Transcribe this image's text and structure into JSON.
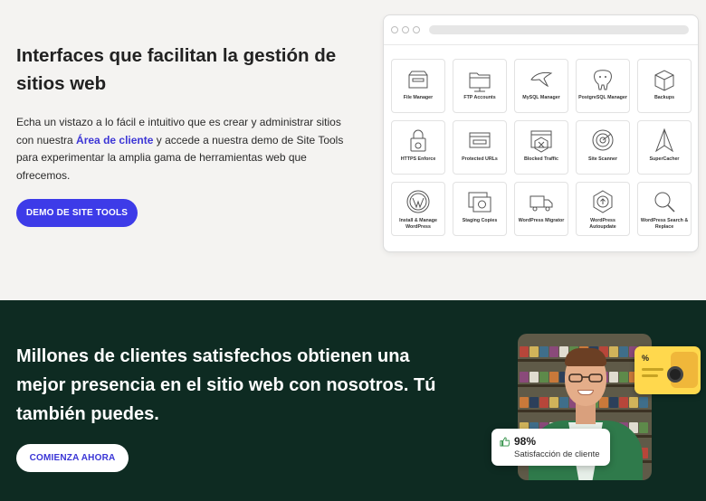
{
  "top": {
    "title": "Interfaces que facilitan la gestión de sitios web",
    "desc_before": "Echa un vistazo a lo fácil e intuitivo que es crear y administrar sitios con nuestra ",
    "desc_link": "Área de cliente",
    "desc_after": " y accede a nuestra demo de Site Tools para experimentar la amplia gama de herramientas web que ofrecemos.",
    "demo_button": "DEMO DE SITE TOOLS"
  },
  "tools": [
    {
      "label": "File Manager",
      "icon": "file-manager-icon"
    },
    {
      "label": "FTP Accounts",
      "icon": "ftp-accounts-icon"
    },
    {
      "label": "MySQL Manager",
      "icon": "mysql-manager-icon"
    },
    {
      "label": "PostgreSQL Manager",
      "icon": "postgresql-manager-icon"
    },
    {
      "label": "Backups",
      "icon": "backups-icon"
    },
    {
      "label": "HTTPS Enforce",
      "icon": "https-enforce-icon"
    },
    {
      "label": "Protected URLs",
      "icon": "protected-urls-icon"
    },
    {
      "label": "Blocked Traffic",
      "icon": "blocked-traffic-icon"
    },
    {
      "label": "Site Scanner",
      "icon": "site-scanner-icon"
    },
    {
      "label": "SuperCacher",
      "icon": "supercacher-icon"
    },
    {
      "label": "Install & Manage WordPress",
      "icon": "wordpress-install-icon"
    },
    {
      "label": "Staging Copies",
      "icon": "staging-copies-icon"
    },
    {
      "label": "WordPress Migrator",
      "icon": "wordpress-migrator-icon"
    },
    {
      "label": "WordPress Autoupdate",
      "icon": "wordpress-autoupdate-icon"
    },
    {
      "label": "WordPress Search & Replace",
      "icon": "search-replace-icon"
    }
  ],
  "bottom": {
    "headline": "Millones de clientes satisfechos obtienen una mejor presencia en el sitio web con nosotros. Tú también puedes.",
    "start_button": "COMIENZA AHORA",
    "mini_card_badge": "%",
    "satisfaction_value": "98%",
    "satisfaction_label": "Satisfacción de cliente"
  },
  "colors": {
    "accent": "#3d3be8",
    "dark_section": "#0e2b22",
    "light_section": "#f4f3f1",
    "mini_card": "#ffd84d"
  }
}
